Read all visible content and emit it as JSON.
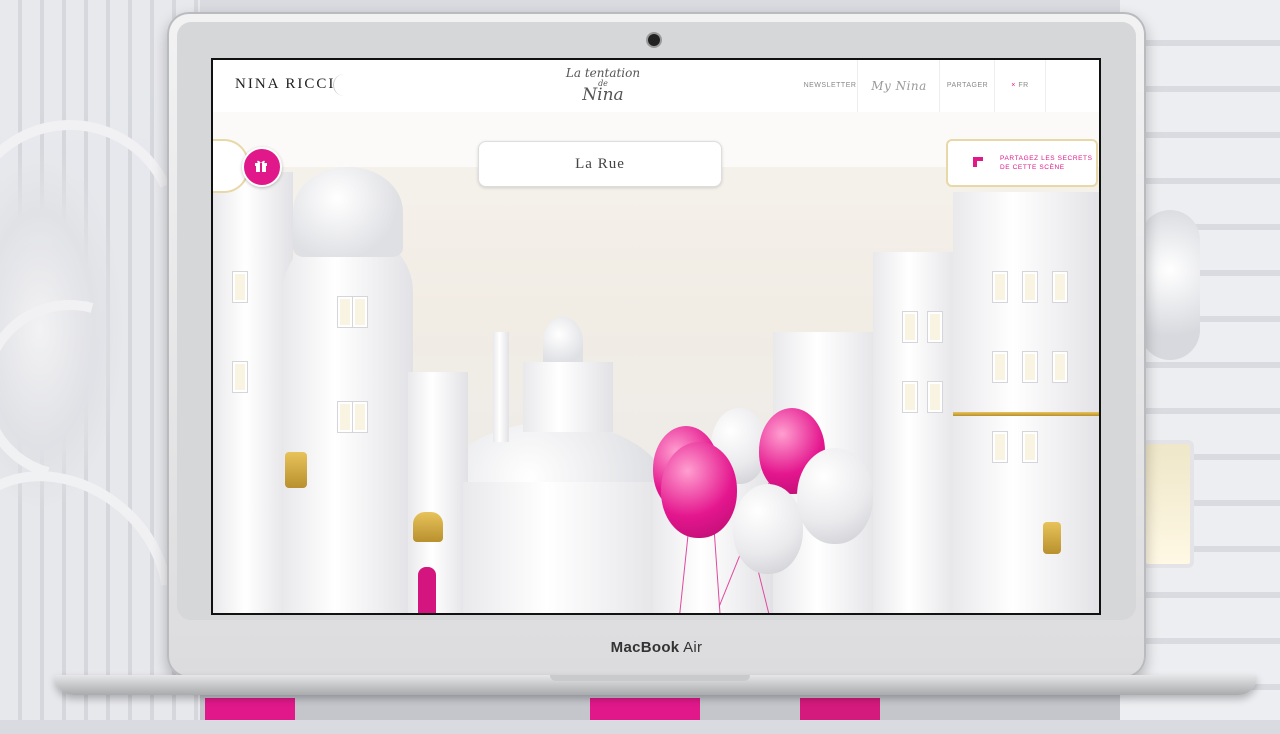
{
  "laptop": {
    "brand_bold": "MacBook",
    "brand_light": "Air"
  },
  "site": {
    "logo": "NINA RICCI",
    "tentation_line1": "La tentation",
    "tentation_line2": "de",
    "tentation_line3": "Nina",
    "nav": {
      "newsletter": "NEWSLETTER",
      "my_nina": "My Nina",
      "partager": "PARTAGER",
      "lang": "FR"
    },
    "scene_title": "La Rue",
    "share_line1": "PARTAGEZ LES SECRETS",
    "share_line2": "DE CETTE SCÈNE",
    "colors": {
      "accent": "#e0188a",
      "gold": "#e8d8a8"
    }
  }
}
